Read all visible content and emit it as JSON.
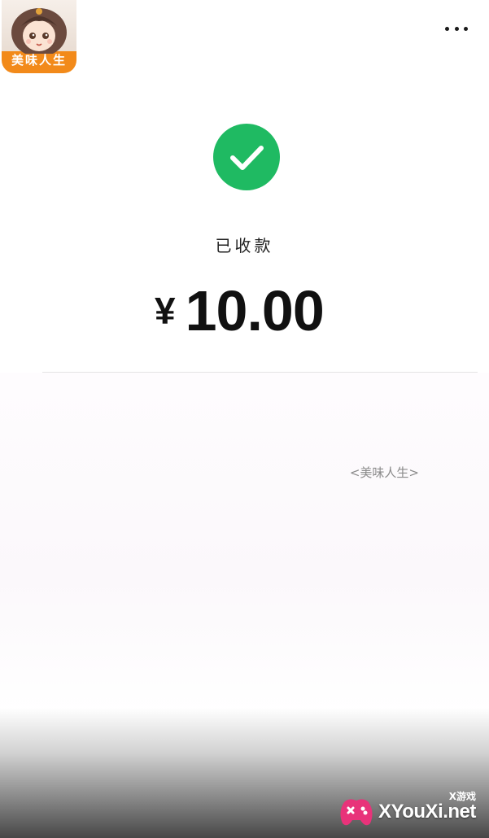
{
  "app_icon": {
    "label": "美味人生",
    "accent": "#f28a1a"
  },
  "header": {
    "more_icon": "more-horizontal-icon"
  },
  "receipt": {
    "status_icon": "check-circle-icon",
    "status_color": "#1fba62",
    "status_text": "已收款",
    "currency_symbol": "¥",
    "amount": "10.00"
  },
  "merchant": {
    "link_text": "<美味人生>"
  },
  "watermark": {
    "small_text": "X游戏",
    "brand_text": "XYouXi.net"
  }
}
